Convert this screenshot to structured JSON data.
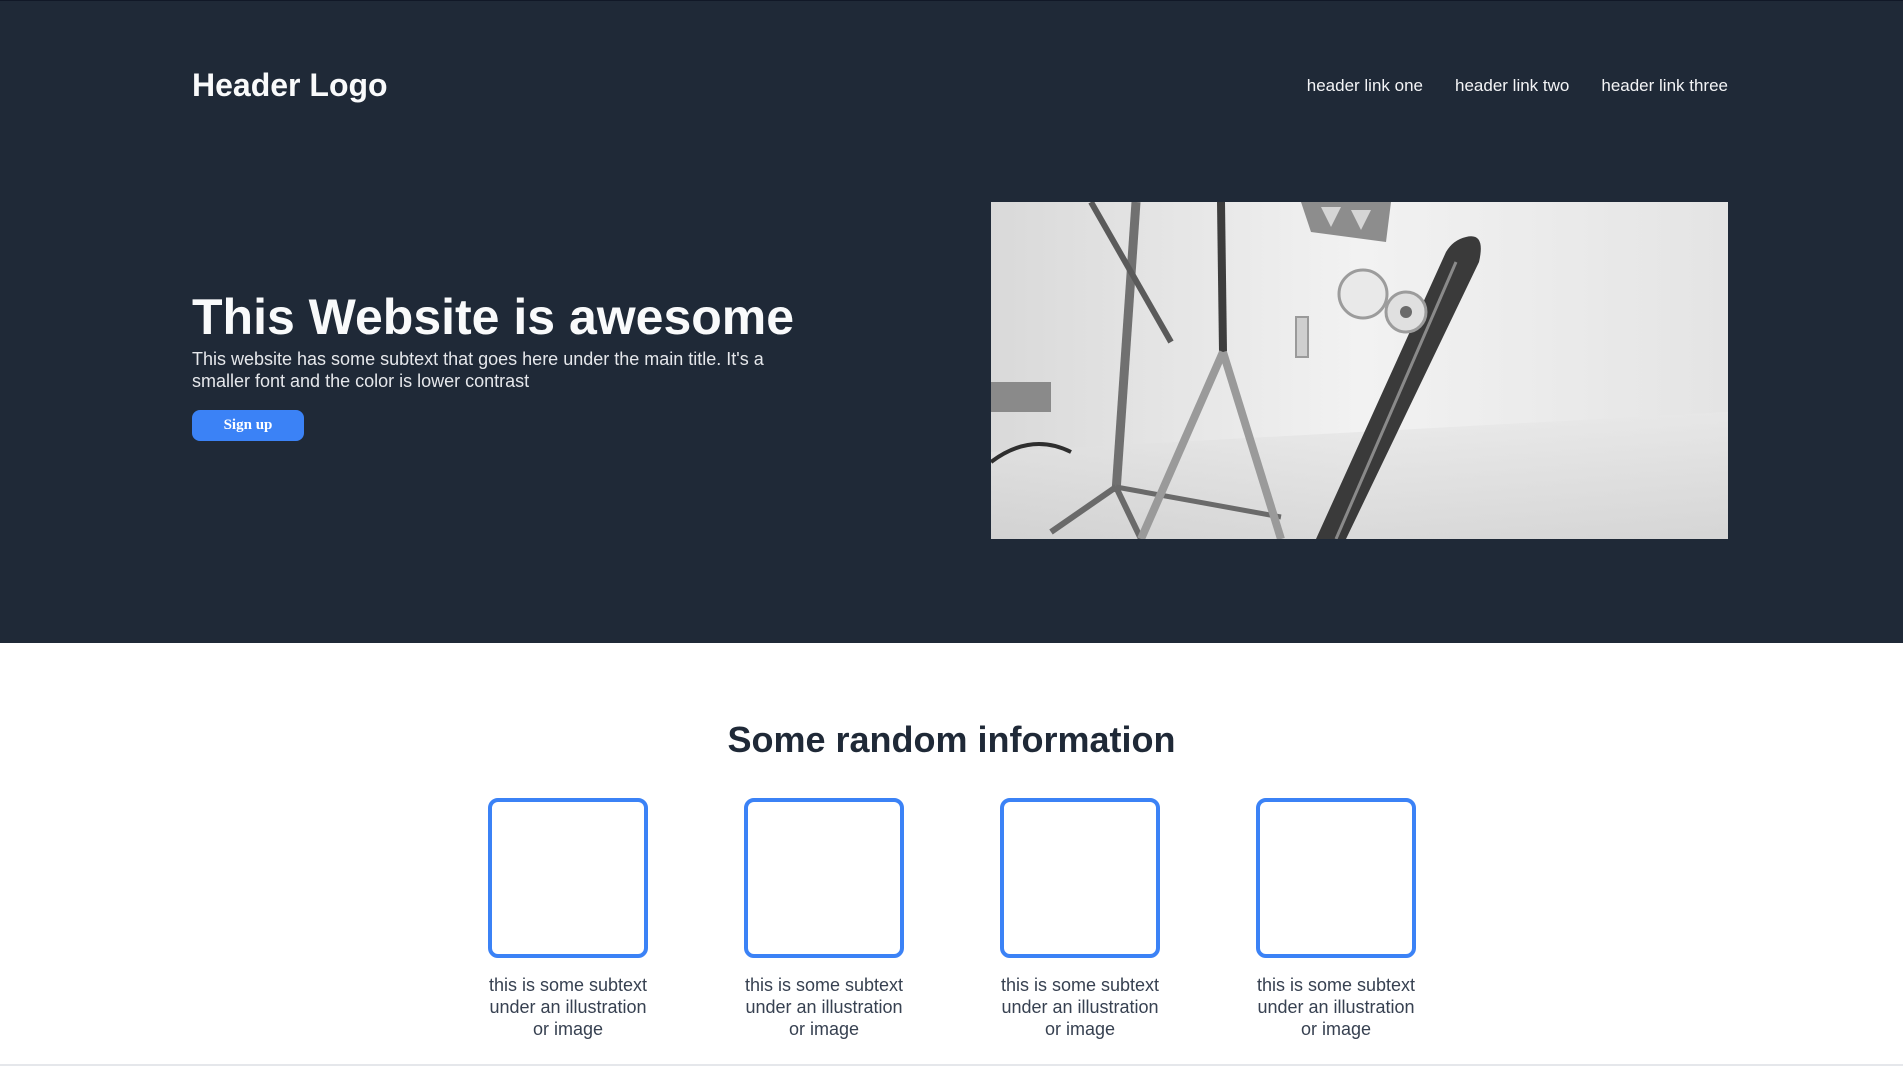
{
  "header": {
    "logo": "Header Logo",
    "links": [
      "header link one",
      "header link two",
      "header link three"
    ]
  },
  "hero": {
    "title": "This Website is awesome",
    "subtitle": "This website has some subtext that goes here under the main title. It's a smaller font and the color is lower contrast",
    "signup_label": "Sign up"
  },
  "info": {
    "title": "Some random information",
    "cards": [
      {
        "text": "this is some subtext under an illustration or image"
      },
      {
        "text": "this is some subtext under an illustration or image"
      },
      {
        "text": "this is some subtext under an illustration or image"
      },
      {
        "text": "this is some subtext under an illustration or image"
      }
    ]
  },
  "colors": {
    "hero_bg": "#1f2937",
    "accent": "#3b82f6",
    "heading": "#1f2937",
    "body_text": "#374151"
  }
}
